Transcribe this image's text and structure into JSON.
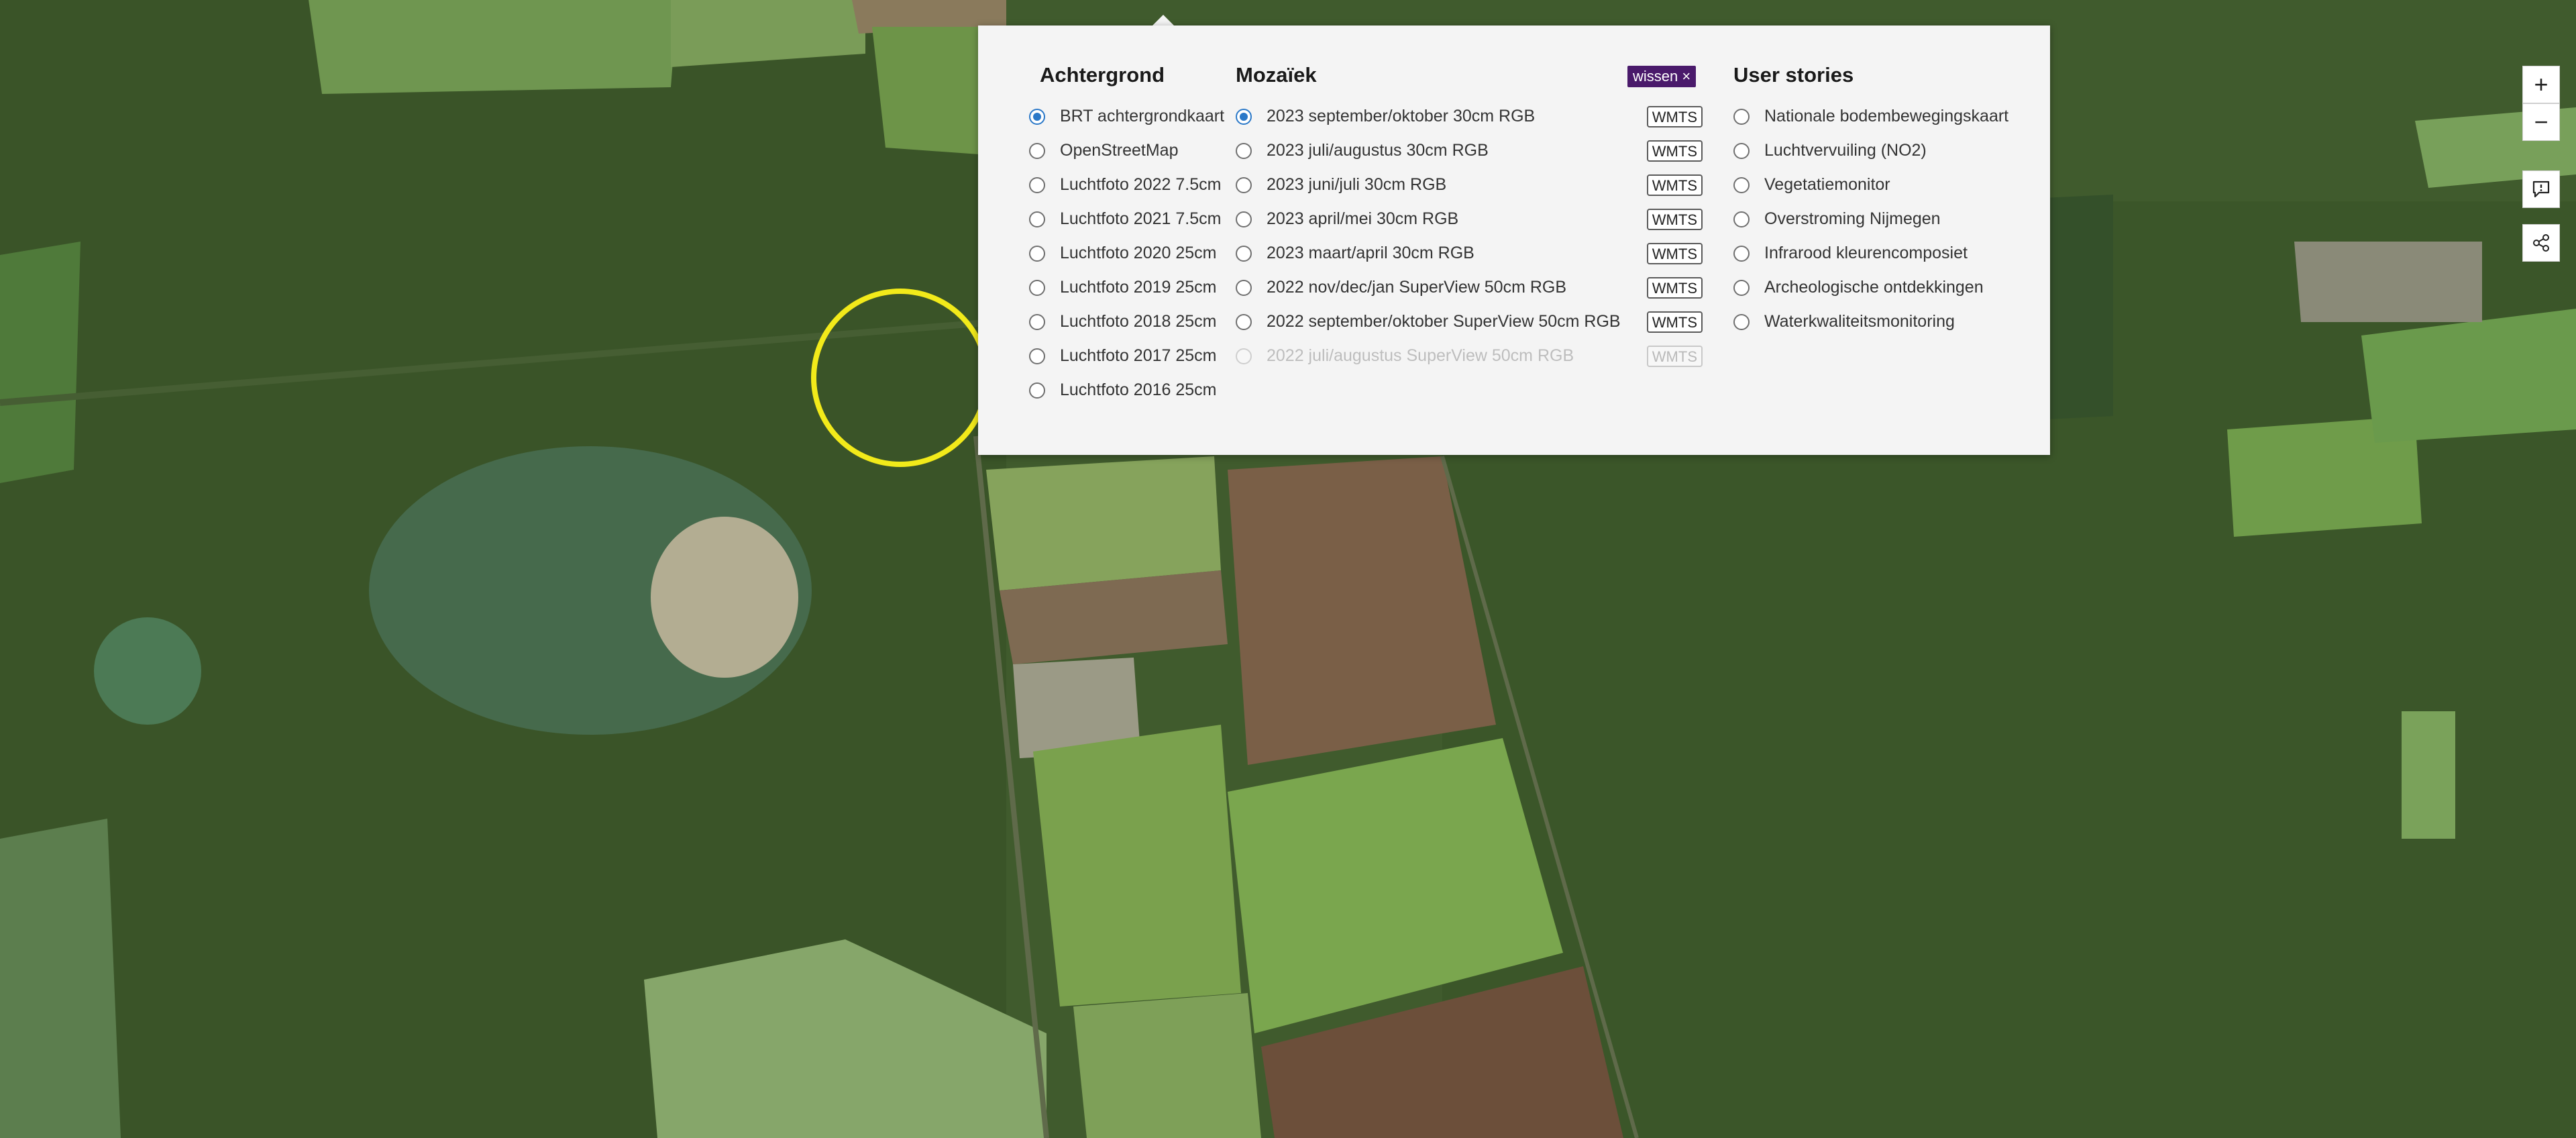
{
  "background": {
    "title": "Achtergrond",
    "items": [
      {
        "label": "BRT achtergrondkaart",
        "selected": true
      },
      {
        "label": "OpenStreetMap",
        "selected": false
      },
      {
        "label": "Luchtfoto 2022 7.5cm",
        "selected": false
      },
      {
        "label": "Luchtfoto 2021 7.5cm",
        "selected": false
      },
      {
        "label": "Luchtfoto 2020 25cm",
        "selected": false
      },
      {
        "label": "Luchtfoto 2019 25cm",
        "selected": false
      },
      {
        "label": "Luchtfoto 2018 25cm",
        "selected": false
      },
      {
        "label": "Luchtfoto 2017 25cm",
        "selected": false
      },
      {
        "label": "Luchtfoto 2016 25cm",
        "selected": false
      }
    ]
  },
  "mosaic": {
    "title": "Mozaïek",
    "clear_label": "wissen ×",
    "items": [
      {
        "label": "2023 september/oktober 30cm RGB",
        "badge": "WMTS",
        "selected": true
      },
      {
        "label": "2023 juli/augustus 30cm RGB",
        "badge": "WMTS",
        "selected": false
      },
      {
        "label": "2023 juni/juli 30cm RGB",
        "badge": "WMTS",
        "selected": false
      },
      {
        "label": "2023 april/mei 30cm RGB",
        "badge": "WMTS",
        "selected": false
      },
      {
        "label": "2023 maart/april 30cm RGB",
        "badge": "WMTS",
        "selected": false
      },
      {
        "label": "2022 nov/dec/jan SuperView 50cm RGB",
        "badge": "WMTS",
        "selected": false
      },
      {
        "label": "2022 september/oktober SuperView 50cm RGB",
        "badge": "WMTS",
        "selected": false
      },
      {
        "label": "2022 juli/augustus SuperView 50cm RGB",
        "badge": "WMTS",
        "selected": false
      }
    ]
  },
  "user_stories": {
    "title": "User stories",
    "items": [
      {
        "label": "Nationale bodembewegingskaart"
      },
      {
        "label": "Luchtvervuiling (NO2)"
      },
      {
        "label": "Vegetatiemonitor"
      },
      {
        "label": "Overstroming Nijmegen"
      },
      {
        "label": "Infrarood kleurencomposiet"
      },
      {
        "label": "Archeologische ontdekkingen"
      },
      {
        "label": "Waterkwaliteitsmonitoring"
      }
    ]
  },
  "controls": {
    "zoom_in": "+",
    "zoom_out": "−",
    "feedback_icon": "comment-icon",
    "share_icon": "share-icon"
  },
  "colors": {
    "selected": "#2a78c8",
    "wissen_bg": "#4a1a6b",
    "highlight": "#f2ea1a"
  }
}
